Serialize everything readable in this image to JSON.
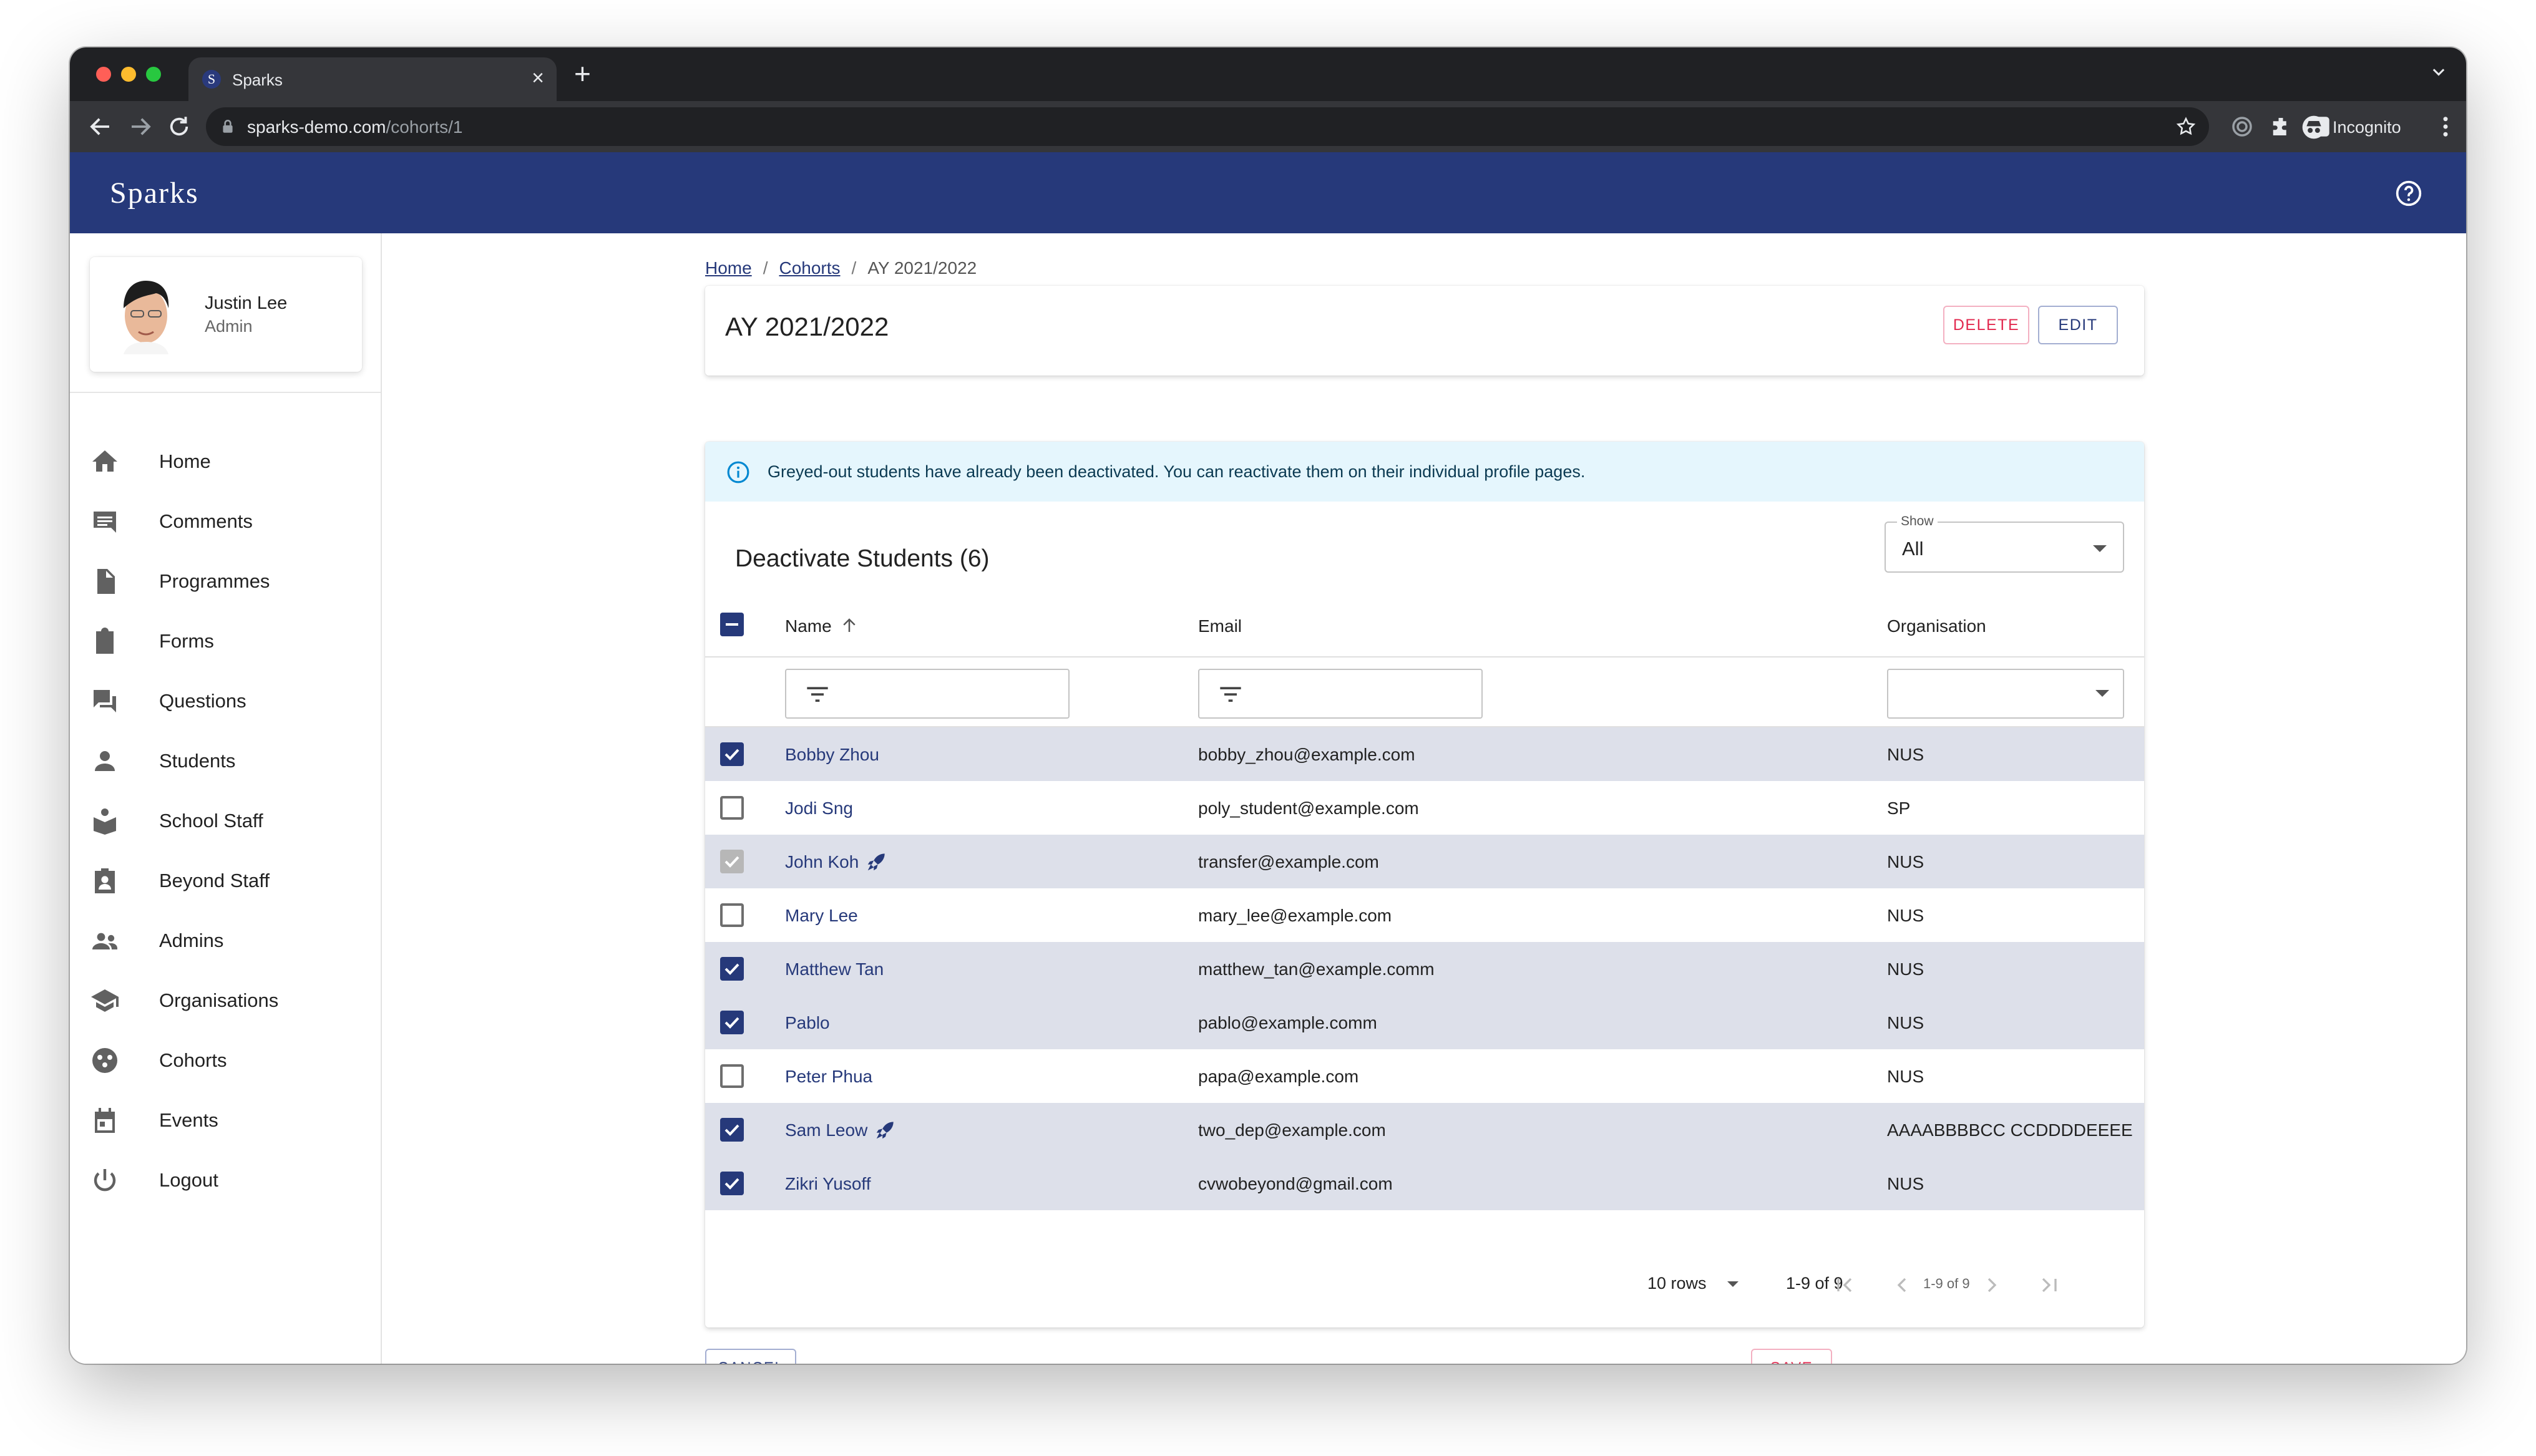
{
  "browser": {
    "tab_title": "Sparks",
    "tab_favicon_letter": "S",
    "url_host": "sparks-demo.com",
    "url_path": "/cohorts/1",
    "profile_label": "Incognito"
  },
  "app": {
    "brand": "Sparks",
    "accent_color": "#26397a"
  },
  "user": {
    "name": "Justin Lee",
    "role": "Admin"
  },
  "nav": {
    "items": [
      {
        "label": "Home",
        "icon": "home-icon"
      },
      {
        "label": "Comments",
        "icon": "comment-icon"
      },
      {
        "label": "Programmes",
        "icon": "document-icon"
      },
      {
        "label": "Forms",
        "icon": "clipboard-icon"
      },
      {
        "label": "Questions",
        "icon": "forum-icon"
      },
      {
        "label": "Students",
        "icon": "person-icon"
      },
      {
        "label": "School Staff",
        "icon": "school-staff-icon"
      },
      {
        "label": "Beyond Staff",
        "icon": "badge-icon"
      },
      {
        "label": "Admins",
        "icon": "people-icon"
      },
      {
        "label": "Organisations",
        "icon": "graduation-cap-icon"
      },
      {
        "label": "Cohorts",
        "icon": "group-workspace-icon"
      },
      {
        "label": "Events",
        "icon": "calendar-icon"
      },
      {
        "label": "Logout",
        "icon": "power-icon"
      }
    ]
  },
  "breadcrumb": {
    "home": "Home",
    "cohorts": "Cohorts",
    "current": "AY 2021/2022",
    "separator": "/"
  },
  "page": {
    "title": "AY 2021/2022",
    "delete_label": "DELETE",
    "edit_label": "EDIT"
  },
  "alert": {
    "text": "Greyed-out students have already been deactivated. You can reactivate them on their individual profile pages."
  },
  "table": {
    "title": "Deactivate Students (6)",
    "show_label": "Show",
    "show_value": "All",
    "columns": {
      "name": "Name",
      "email": "Email",
      "organisation": "Organisation"
    },
    "sort_icon": "arrow-up-icon",
    "rows": [
      {
        "name": "Bobby Zhou",
        "email": "bobby_zhou@example.com",
        "org": "NUS",
        "checked": true,
        "deactivated": false,
        "rocket": false
      },
      {
        "name": "Jodi Sng",
        "email": "poly_student@example.com",
        "org": "SP",
        "checked": false,
        "deactivated": false,
        "rocket": false
      },
      {
        "name": "John Koh",
        "email": "transfer@example.com",
        "org": "NUS",
        "checked": true,
        "deactivated": true,
        "rocket": true
      },
      {
        "name": "Mary Lee",
        "email": "mary_lee@example.com",
        "org": "NUS",
        "checked": false,
        "deactivated": false,
        "rocket": false
      },
      {
        "name": "Matthew Tan",
        "email": "matthew_tan@example.comm",
        "org": "NUS",
        "checked": true,
        "deactivated": false,
        "rocket": false
      },
      {
        "name": "Pablo",
        "email": "pablo@example.comm",
        "org": "NUS",
        "checked": true,
        "deactivated": false,
        "rocket": false
      },
      {
        "name": "Peter Phua",
        "email": "papa@example.com",
        "org": "NUS",
        "checked": false,
        "deactivated": false,
        "rocket": false
      },
      {
        "name": "Sam Leow",
        "email": "two_dep@example.com",
        "org": "AAAABBBBCC CCDDDDEEEE",
        "checked": true,
        "deactivated": false,
        "rocket": true
      },
      {
        "name": "Zikri Yusoff",
        "email": "cvwobeyond@gmail.com",
        "org": "NUS",
        "checked": true,
        "deactivated": false,
        "rocket": false
      }
    ],
    "pagination": {
      "rows_per_page": "10 rows",
      "range": "1-9 of 9",
      "range_small": "1-9 of 9"
    }
  },
  "footer": {
    "cancel_label": "CANCEL",
    "save_label": "SAVE"
  },
  "colors": {
    "selected_row": "#dde0ea",
    "alert_bg": "#e5f6fd",
    "danger": "#e2294f"
  }
}
